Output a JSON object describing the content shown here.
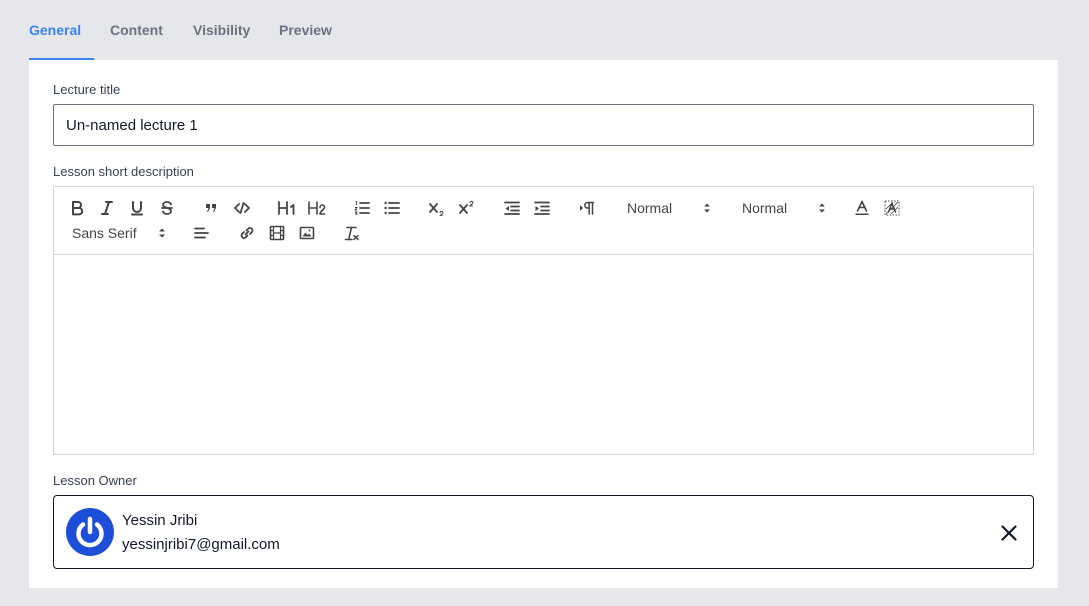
{
  "tabs": [
    {
      "label": "General",
      "active": true
    },
    {
      "label": "Content",
      "active": false
    },
    {
      "label": "Visibility",
      "active": false
    },
    {
      "label": "Preview",
      "active": false
    }
  ],
  "form": {
    "lecture_title_label": "Lecture title",
    "lecture_title_value": "Un-named lecture 1",
    "description_label": "Lesson short description",
    "owner_label": "Lesson Owner"
  },
  "editor": {
    "header_picker": "Normal",
    "size_picker": "Normal",
    "font_picker": "Sans Serif",
    "icons": [
      "bold-icon",
      "italic-icon",
      "underline-icon",
      "strike-icon",
      "blockquote-icon",
      "code-block-icon",
      "header-1-icon",
      "header-2-icon",
      "ordered-list-icon",
      "bullet-list-icon",
      "subscript-icon",
      "superscript-icon",
      "outdent-icon",
      "indent-icon",
      "rtl-direction-icon",
      "font-color-icon",
      "background-color-icon",
      "align-icon",
      "link-icon",
      "video-icon",
      "image-icon",
      "clear-format-icon"
    ],
    "body": ""
  },
  "owner": {
    "name": "Yessin Jribi",
    "email": "yessinjribi7@gmail.com",
    "avatar_color": "#1d4ed8"
  },
  "colors": {
    "accent": "#3b82f6",
    "background": "#e5e7eb"
  }
}
